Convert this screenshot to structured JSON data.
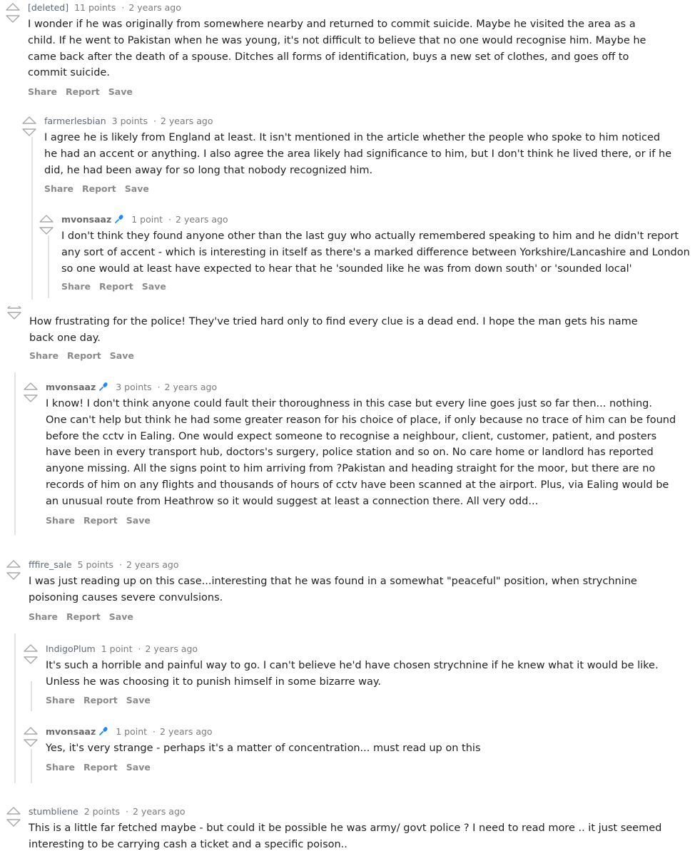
{
  "actions": {
    "share": "Share",
    "report": "Report",
    "save": "Save"
  },
  "comments": [
    {
      "author": "[deleted]",
      "points": "11 points",
      "time": "2 years ago",
      "lines": [
        "I wonder if he was originally from somewhere nearby and returned to commit suicide. Maybe he visited the area as a",
        "child. If he went to Pakistan when he was young, it's not difficult to believe that no one would recognise him. Maybe he",
        "came back after the death of a spouse. Ditches all forms of identification, buys a new set of clothes, and goes off to",
        "commit suicide."
      ]
    },
    {
      "author": "farmerlesbian",
      "points": "3 points",
      "time": "2 years ago",
      "lines": [
        "I agree he is likely from England at least. It isn't mentioned in the article whether the people who spoke to him noticed",
        "he had an accent or anything. I also agree the area likely had significance to him, but I don't think he lived there, or if he",
        "did, he had been away for so long that nobody recognized him."
      ]
    },
    {
      "author": "mvonsaaz",
      "points": "1 point",
      "time": "2 years ago",
      "lines": [
        "I don't think they found anyone other than the last guy who actually remembered speaking to him and he didn't report",
        "any sort of accent - which is interesting in itself as there's a marked difference between Yorkshire/Lancashire and London",
        "so one would at least have expected to hear that he 'sounded like he was from down south' or 'sounded local'"
      ]
    },
    {
      "author": "",
      "points": "",
      "time": "",
      "lines": [
        "How frustrating for the police! They've tried hard only to find every clue is a dead end. I hope the man gets his name",
        "back one day."
      ]
    },
    {
      "author": "mvonsaaz",
      "points": "3 points",
      "time": "2 years ago",
      "lines": [
        "I know! I don't think anyone could fault their thoroughness in this case but every line goes just so far then... nothing.",
        "One can't help but think he had some greater reason for his choice of place, if only because no trace of him can be found",
        "before the cctv in Ealing. One would expect someone to recognise a neighbour, client, customer, patient, and posters",
        "have been in every transport hub, doctors's surgery, police station and so on. No care home or landlord has reported",
        "anyone missing. All the signs point to him arriving from ?Pakistan and heading straight for the moor, but there are no",
        "records of him on any flights and thousands of hours of cctv have been scanned at the airport. Plus, via Ealing would be",
        "an unusual route from Heathrow so it would suggest at least a connection there. All very odd..."
      ]
    },
    {
      "author": "fffire_sale",
      "points": "5 points",
      "time": "2 years ago",
      "lines": [
        "I was just reading up on this case...interesting that he was found in a somewhat \"peaceful\" position, when strychnine",
        "poisoning causes severe convulsions."
      ]
    },
    {
      "author": "IndigoPlum",
      "points": "1 point",
      "time": "2 years ago",
      "lines": [
        "It's such a horrible and painful way to go. I can't believe he'd have chosen strychnine if he knew what it would be like.",
        "Unless he was choosing it to punish himself in some bizarre way."
      ]
    },
    {
      "author": "mvonsaaz",
      "points": "1 point",
      "time": "2 years ago",
      "lines": [
        "Yes, it's very strange - perhaps it's a matter of concentration... must read up on this"
      ]
    },
    {
      "author": "stumbliene",
      "points": "2 points",
      "time": "2 years ago",
      "lines": [
        "This is a little far fetched maybe - but could it be possible he was army/ govt police ? I need to read more .. it just seemed",
        "interesting to be carrying cash a ticket and a specific poison.."
      ]
    }
  ]
}
